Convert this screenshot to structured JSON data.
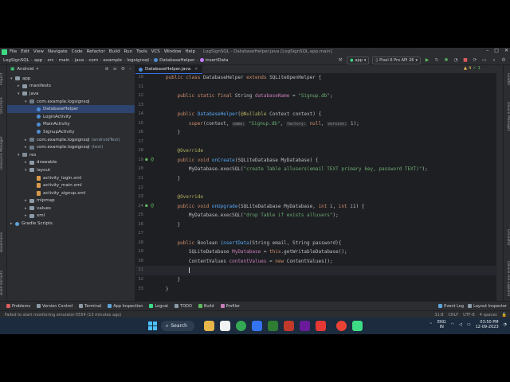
{
  "menu": {
    "items": [
      "File",
      "Edit",
      "View",
      "Navigate",
      "Code",
      "Refactor",
      "Build",
      "Run",
      "Tools",
      "VCS",
      "Window",
      "Help"
    ],
    "window_title": "LogSignSQL - DatabaseHelper.java [LogSignSQL.app.main]"
  },
  "nav": {
    "crumbs": [
      "LogSignSQL",
      "app",
      "src",
      "main",
      "java",
      "com",
      "example",
      "logsignsql",
      "DatabaseHelper",
      "insertData"
    ],
    "run_config": "app",
    "device": "Pixel 6 Pro API 26"
  },
  "project": {
    "view": "Android",
    "tree": [
      {
        "label": "app",
        "depth": 0,
        "arrow": "▾",
        "icon": "folder"
      },
      {
        "label": "manifests",
        "depth": 1,
        "arrow": "▸",
        "icon": "folder"
      },
      {
        "label": "java",
        "depth": 1,
        "arrow": "▾",
        "icon": "folder"
      },
      {
        "label": "com.example.logsignsql",
        "depth": 2,
        "arrow": "▾",
        "icon": "pkg"
      },
      {
        "label": "DatabaseHelper",
        "depth": 3,
        "arrow": "",
        "icon": "cls",
        "selected": true
      },
      {
        "label": "LoginActivity",
        "depth": 3,
        "arrow": "",
        "icon": "cls"
      },
      {
        "label": "MainActivity",
        "depth": 3,
        "arrow": "",
        "icon": "cls"
      },
      {
        "label": "SignupActivity",
        "depth": 3,
        "arrow": "",
        "icon": "cls"
      },
      {
        "label": "com.example.logsignsql",
        "depth": 2,
        "arrow": "▸",
        "icon": "pkg",
        "note": "(androidTest)"
      },
      {
        "label": "com.example.logsignsql",
        "depth": 2,
        "arrow": "▸",
        "icon": "pkg",
        "note": "(test)"
      },
      {
        "label": "res",
        "depth": 1,
        "arrow": "▾",
        "icon": "res"
      },
      {
        "label": "drawable",
        "depth": 2,
        "arrow": "▸",
        "icon": "folder"
      },
      {
        "label": "layout",
        "depth": 2,
        "arrow": "▾",
        "icon": "folder"
      },
      {
        "label": "activity_login.xml",
        "depth": 3,
        "arrow": "",
        "icon": "xml"
      },
      {
        "label": "activity_main.xml",
        "depth": 3,
        "arrow": "",
        "icon": "xml"
      },
      {
        "label": "activity_signup.xml",
        "depth": 3,
        "arrow": "",
        "icon": "xml"
      },
      {
        "label": "mipmap",
        "depth": 2,
        "arrow": "▸",
        "icon": "folder"
      },
      {
        "label": "values",
        "depth": 2,
        "arrow": "▸",
        "icon": "folder"
      },
      {
        "label": "xml",
        "depth": 2,
        "arrow": "▸",
        "icon": "folder"
      },
      {
        "label": "Gradle Scripts",
        "depth": 0,
        "arrow": "▸",
        "icon": "gradle"
      }
    ]
  },
  "editor": {
    "tab": "DatabaseHelper.java",
    "warnings": "▲ 4",
    "ok": "✓ 1",
    "lines": [
      {
        "n": "10",
        "html": "<span class='kw'>public class</span> DatabaseHelper <span class='kw'>extends</span> SQLiteOpenHelper {"
      },
      {
        "n": "11",
        "html": ""
      },
      {
        "n": "12",
        "html": "    <span class='kw'>public static final</span> String <span class='fld'>databaseName</span> = <span class='st'>\"Signup.db\"</span>;"
      },
      {
        "n": "13",
        "html": ""
      },
      {
        "n": "14",
        "html": "    <span class='kw'>public</span> <span class='fn'>DatabaseHelper</span>(<span class='an'>@Nullable</span> Context context) {"
      },
      {
        "n": "15",
        "html": "        <span class='kw'>super</span>(context, <span class='hint'>name:</span> <span class='st'>\"Signup.db\"</span>, <span class='hint'>factory:</span> <span class='kw'>null</span>, <span class='hint'>version:</span> 1);"
      },
      {
        "n": "16",
        "html": "    }"
      },
      {
        "n": "17",
        "html": ""
      },
      {
        "n": "18",
        "html": "    <span class='an'>@Override</span>"
      },
      {
        "n": "19",
        "mark": "● @",
        "html": "    <span class='kw'>public void</span> <span class='fn'>onCreate</span>(SQLiteDatabase MyDatabase) {"
      },
      {
        "n": "20",
        "html": "        MyDatabase.execSQL(<span class='st'>\"create Table allusers(email TEXT primary key, password TEXT)\"</span>);"
      },
      {
        "n": "21",
        "html": "    }"
      },
      {
        "n": "22",
        "html": ""
      },
      {
        "n": "23",
        "html": "    <span class='an'>@Override</span>"
      },
      {
        "n": "24",
        "mark": "● @",
        "html": "    <span class='kw'>public void</span> <span class='fn'>onUpgrade</span>(SQLiteDatabase MyDatabase, <span class='kw'>int</span> i, <span class='kw'>int</span> i1) {"
      },
      {
        "n": "25",
        "html": "        MyDatabase.execSQL(<span class='st'>\"drop Table if exists allusers\"</span>);"
      },
      {
        "n": "26",
        "html": "    }"
      },
      {
        "n": "27",
        "html": ""
      },
      {
        "n": "28",
        "html": "    <span class='kw'>public</span> Boolean <span class='fn'>insertData</span>(String email, String password){"
      },
      {
        "n": "29",
        "html": "        SQLiteDatabase <span class='fld'>MyDatabase</span> = <span class='kw'>this</span>.getWritableDatabase();"
      },
      {
        "n": "30",
        "html": "        ContentValues <span class='fld'>contentValues</span> = <span class='kw'>new</span> ContentValues();"
      },
      {
        "n": "31",
        "cur": true,
        "html": "        <span class='caret'></span>"
      },
      {
        "n": "32",
        "html": "    }"
      },
      {
        "n": "33",
        "html": "}"
      }
    ]
  },
  "bottom_tools": [
    "Problems",
    "Version Control",
    "Terminal",
    "App Inspection",
    "Logcat",
    "TODO",
    "Build",
    "Profiler"
  ],
  "bottom_right": [
    "Event Log",
    "Layout Inspector"
  ],
  "status": {
    "message": "Failed to start monitoring emulator-5554 (13 minutes ago)",
    "right": [
      "31:8",
      "CRLF",
      "UTF-8",
      "4 spaces"
    ]
  },
  "left_strip": [
    "Project",
    "Structure",
    "Resource Manager",
    "Bookmarks",
    "Build Variants"
  ],
  "right_strip": [
    "Gradle",
    "Device Manager",
    "Emulator",
    "Device File Explorer"
  ],
  "taskbar": {
    "search": "Search",
    "lang_top": "ENG",
    "lang_bottom": "IN",
    "time": "03:50 PM",
    "date": "12-09-2023"
  }
}
